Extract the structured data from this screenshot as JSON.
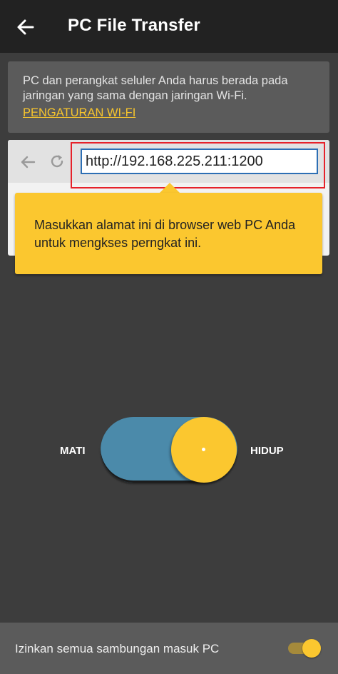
{
  "app_bar": {
    "title": "PC File Transfer"
  },
  "info": {
    "message": "PC dan perangkat seluler Anda harus berada pada jaringan yang sama dengan jaringan Wi-Fi.",
    "link": "PENGATURAN WI-FI"
  },
  "browser": {
    "url": "http://192.168.225.211:1200"
  },
  "tooltip": {
    "text": "Masukkan alamat ini di browser web PC Anda untuk mengkses perngkat ini."
  },
  "power_toggle": {
    "off_label": "MATI",
    "on_label": "HIDUP",
    "state": "on"
  },
  "bottom": {
    "label": "Izinkan semua sambungan masuk PC",
    "switch_state": "on"
  },
  "colors": {
    "accent": "#fbc72f",
    "toggle_track": "#4b8aaa",
    "highlight": "#e6212a",
    "background": "#3d3d3d"
  }
}
